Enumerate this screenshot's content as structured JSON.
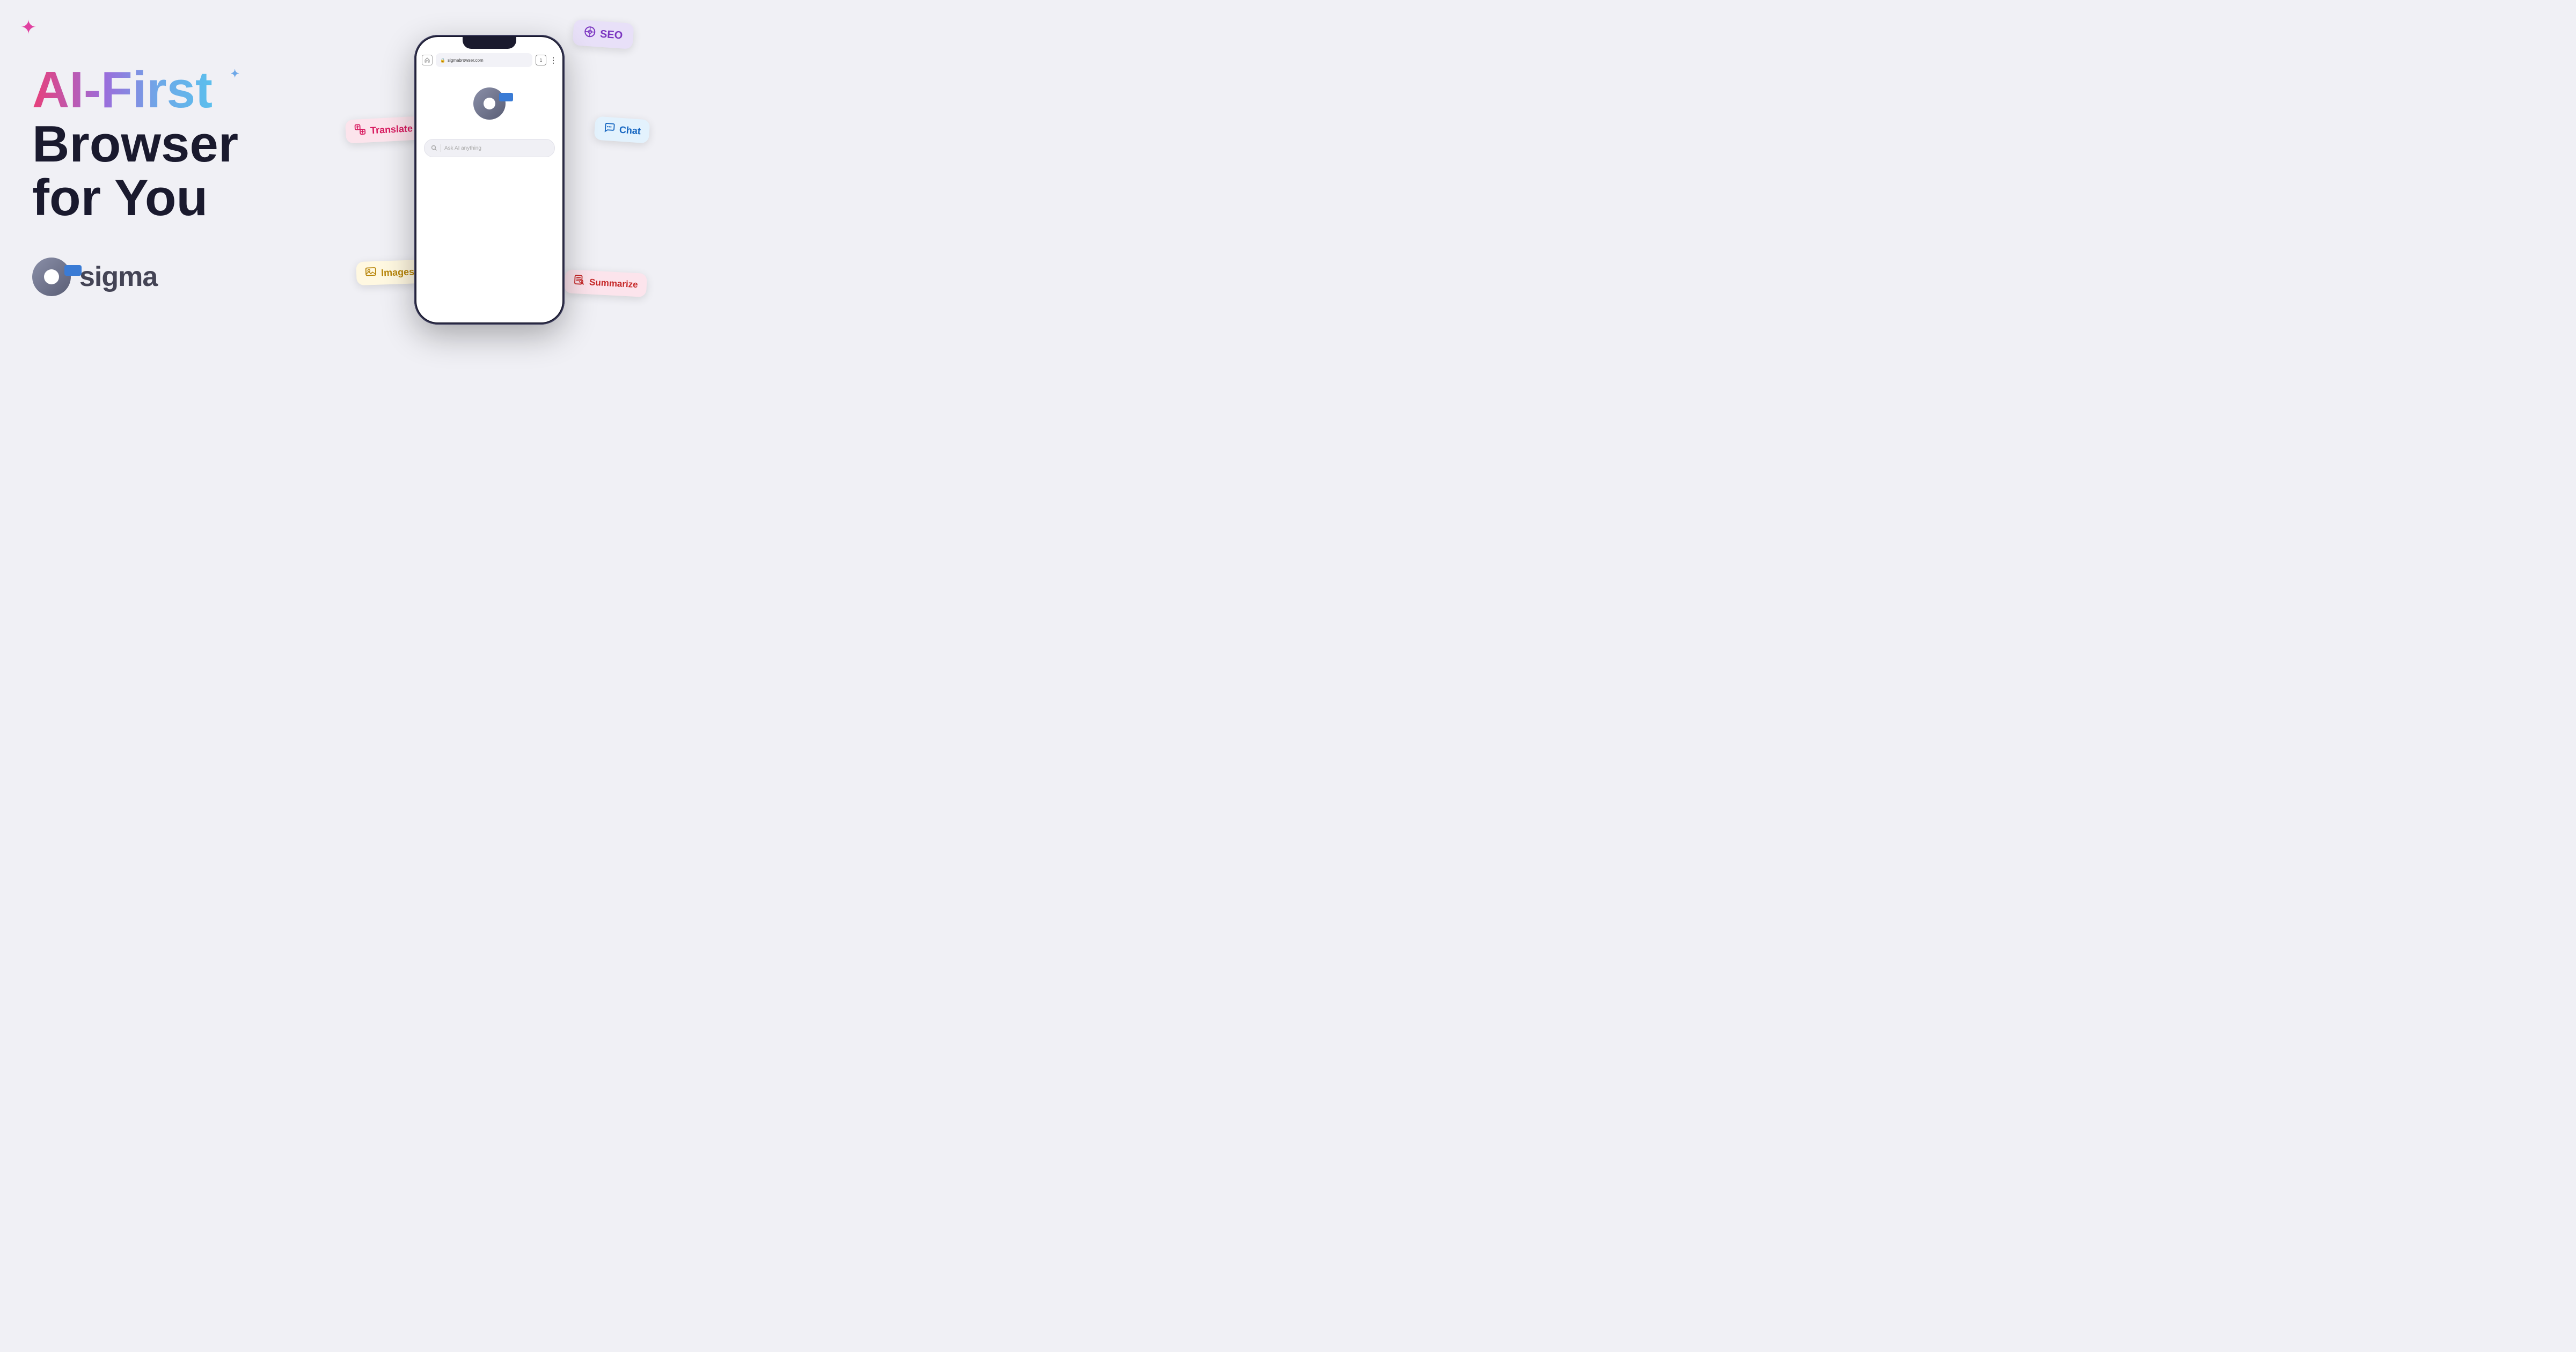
{
  "page": {
    "background_color": "#f0f0f5"
  },
  "headline": {
    "line1": "AI-First",
    "star_decoration": "✦",
    "line2": "Browser for You"
  },
  "logo": {
    "name": "sigma",
    "text": "sigma"
  },
  "phone": {
    "url": "sigmabrowser.com",
    "search_placeholder": "Ask AI anything"
  },
  "chips": {
    "seo": {
      "label": "SEO",
      "icon": "♻"
    },
    "translate": {
      "label": "Translate",
      "icon": "🔤"
    },
    "chat": {
      "label": "Chat",
      "icon": "💬"
    },
    "images": {
      "label": "Images",
      "icon": "🖼"
    },
    "summarize": {
      "label": "Summarize",
      "icon": "📋"
    }
  },
  "decorations": {
    "star_top_left": "✦",
    "star_small_blue": "✦"
  }
}
